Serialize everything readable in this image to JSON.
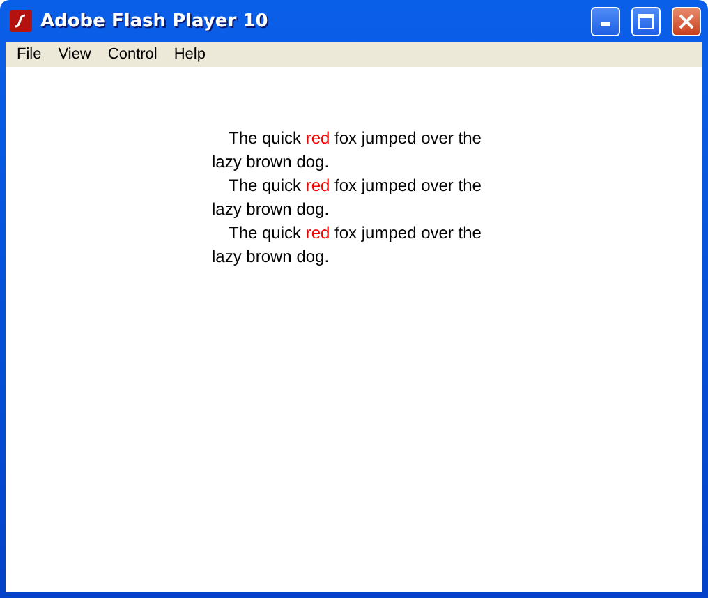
{
  "window": {
    "title": "Adobe Flash Player 10"
  },
  "menu": [
    "File",
    "View",
    "Control",
    "Help"
  ],
  "paragraphs": [
    {
      "before": "The quick ",
      "highlight": "red",
      "after": " fox jumped over the lazy brown dog."
    },
    {
      "before": "The quick ",
      "highlight": "red",
      "after": " fox jumped over the lazy brown dog."
    },
    {
      "before": "The quick ",
      "highlight": "red",
      "after": " fox jumped over the lazy brown dog."
    }
  ]
}
